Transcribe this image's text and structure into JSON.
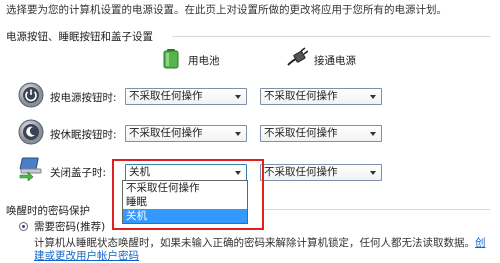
{
  "intro_text": "选择要为您的计算机设置的电源设置。在此页上对设置所做的更改将应用于您所有的电源计划。",
  "buttons_section": {
    "title": "电源按钮、睡眠按钮和盖子设置",
    "battery_label": "用电池",
    "plugged_in_label": "接通电源",
    "rows": [
      {
        "label": "按电源按钮时:",
        "battery_value": "不采取任何操作",
        "plugged_value": "不采取任何操作"
      },
      {
        "label": "按休眠按钮时:",
        "battery_value": "不采取任何操作",
        "plugged_value": "不采取任何操作"
      },
      {
        "label": "关闭盖子时:",
        "battery_value": "关机",
        "plugged_value": "不采取任何操作"
      }
    ],
    "dropdown_options": [
      "不采取任何操作",
      "睡眠",
      "关机"
    ],
    "dropdown_selected_index": 2
  },
  "password_section": {
    "title": "唤醒时的密码保护",
    "radio_label": "需要密码(推荐)",
    "description": "计算机从睡眠状态唤醒时，如果未输入正确的密码来解除计算机锁定，任何人都无法读取数据。",
    "link_part1": "创",
    "link_part2": "建或更改用户帐户密码"
  },
  "colors": {
    "highlight_border": "#e0201e",
    "selection_bg": "#3399ff",
    "link": "#1166cc"
  }
}
